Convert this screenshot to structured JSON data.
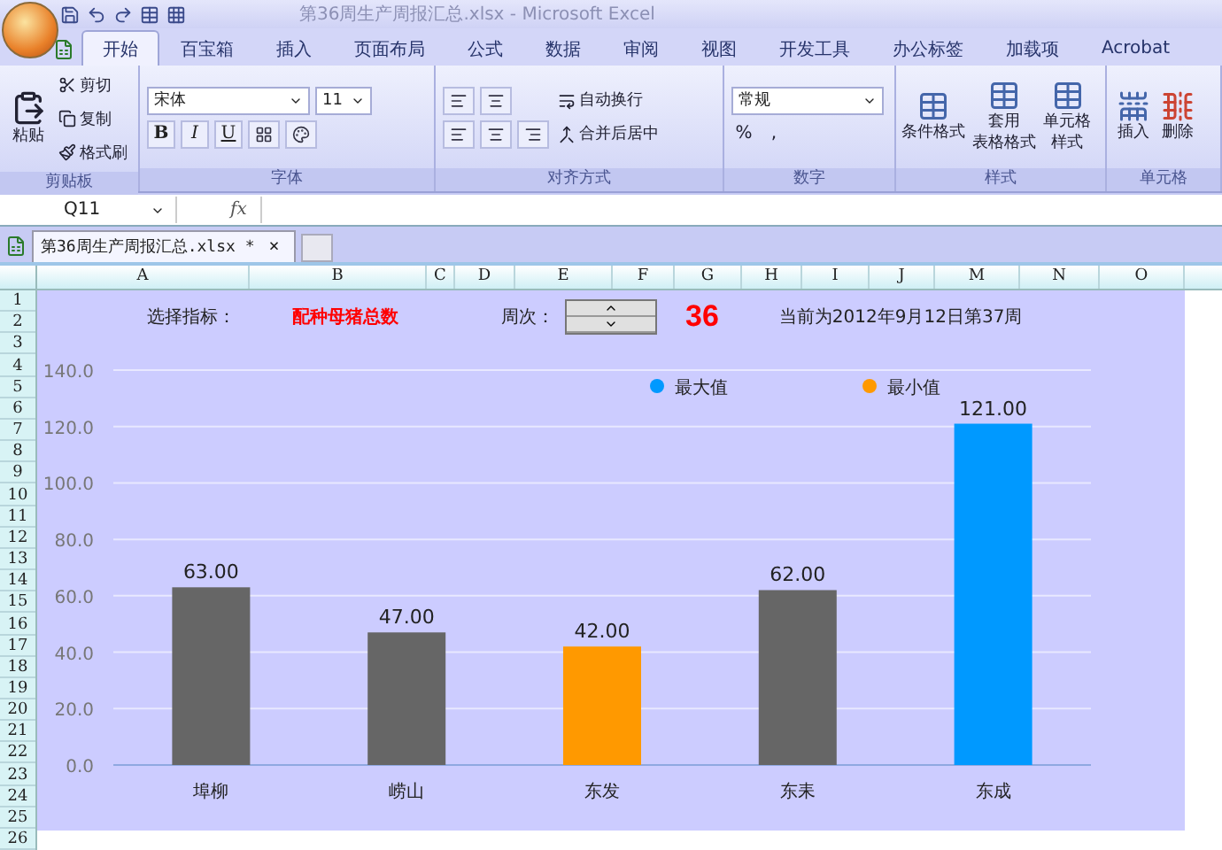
{
  "window": {
    "title": "第36周生产周报汇总.xlsx - Microsoft Excel"
  },
  "tabs": [
    {
      "label": "开始",
      "selected": true
    },
    {
      "label": "百宝箱",
      "selected": false
    },
    {
      "label": "插入",
      "selected": false
    },
    {
      "label": "页面布局",
      "selected": false
    },
    {
      "label": "公式",
      "selected": false
    },
    {
      "label": "数据",
      "selected": false
    },
    {
      "label": "审阅",
      "selected": false
    },
    {
      "label": "视图",
      "selected": false
    },
    {
      "label": "开发工具",
      "selected": false
    },
    {
      "label": "办公标签",
      "selected": false
    },
    {
      "label": "加载项",
      "selected": false
    },
    {
      "label": "Acrobat",
      "selected": false
    }
  ],
  "ribbon": {
    "clipboard": {
      "label": "剪贴板",
      "paste": "粘贴",
      "items": [
        "剪切",
        "复制",
        "格式刷"
      ]
    },
    "font": {
      "label": "字体",
      "name": "宋体",
      "size": "11",
      "styles": [
        "B",
        "I",
        "U"
      ]
    },
    "alignment": {
      "label": "对齐方式",
      "items": [
        "自动换行",
        "合并后居中"
      ]
    },
    "number": {
      "label": "数字",
      "format": "常规",
      "symbols": [
        "%",
        ","
      ]
    },
    "styles": {
      "label": "样式",
      "items": [
        [
          "条件格式"
        ],
        [
          "套用",
          "表格格式"
        ],
        [
          "单元格",
          "样式"
        ]
      ]
    },
    "cells": {
      "label": "单元格",
      "items": [
        "插入",
        "删除"
      ]
    }
  },
  "formula_bar": {
    "name_box": "Q11",
    "fx": "fx"
  },
  "workbook_tab": {
    "label": "第36周生产周报汇总.xlsx *",
    "close": "×"
  },
  "columns": [
    "A",
    "B",
    "C",
    "D",
    "E",
    "F",
    "G",
    "H",
    "I",
    "J",
    "M",
    "N",
    "O"
  ],
  "rows": [
    "1",
    "2",
    "3",
    "4",
    "5",
    "6",
    "7",
    "8",
    "9",
    "10",
    "11",
    "12",
    "13",
    "14",
    "15",
    "16",
    "17",
    "18",
    "19",
    "20",
    "21",
    "22",
    "23",
    "24",
    "25",
    "26"
  ],
  "sheet": {
    "indicator_label": "选择指标：",
    "indicator": "配种母猪总数",
    "week_label": "周次：",
    "week": "36",
    "current": "当前为2012年9月12日第37周"
  },
  "chart": {
    "chart_data": {
      "type": "bar",
      "stacked": true,
      "grid": true,
      "legend": true,
      "categories": [
        "埠柳",
        "崂山",
        "东发",
        "东耒",
        "东成"
      ],
      "series": [
        {
          "color": "#666666",
          "values": [
            63,
            47,
            null,
            62,
            null
          ]
        },
        {
          "name": "最大值",
          "color": "#0099ff",
          "values": [
            null,
            null,
            null,
            null,
            121
          ]
        },
        {
          "name": "最小值",
          "color": "#ff9900",
          "values": [
            null,
            null,
            42,
            null,
            null
          ]
        }
      ],
      "ylim": [
        0,
        140
      ],
      "yticks": [
        {
          "value": 0,
          "label": "0.0"
        },
        {
          "value": 20,
          "label": "20.0"
        },
        {
          "value": 40,
          "label": "40.0"
        },
        {
          "value": 60,
          "label": "60.0"
        },
        {
          "value": 80,
          "label": "80.0"
        },
        {
          "value": 100,
          "label": "100.0"
        },
        {
          "value": 120,
          "label": "120.0"
        },
        {
          "value": 140,
          "label": "140.0"
        }
      ],
      "value_labels": [
        "63.00",
        "47.00",
        "42.00",
        "62.00",
        "121.00"
      ]
    }
  }
}
